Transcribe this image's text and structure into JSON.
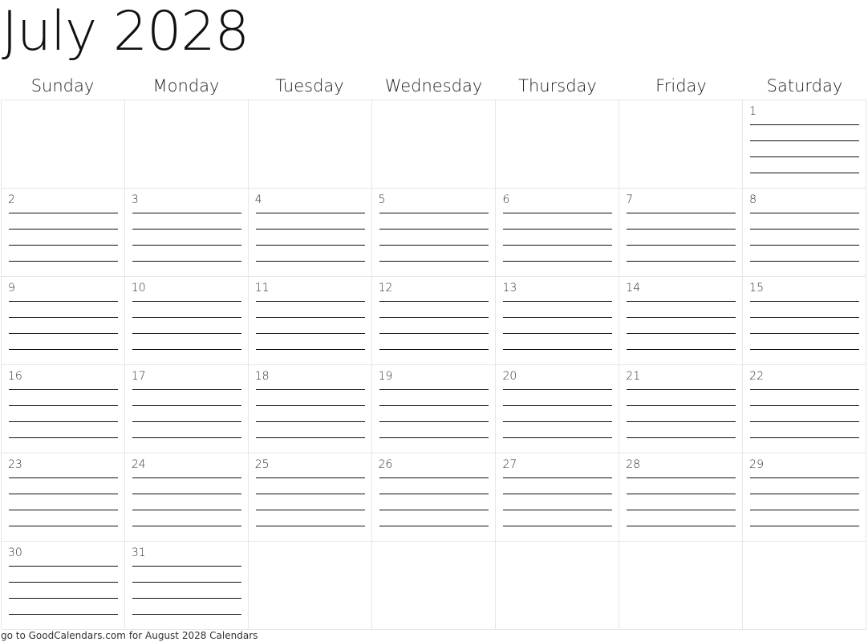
{
  "header": {
    "title": "July 2028",
    "month": "July",
    "year": "2028"
  },
  "weekdays": [
    "Sunday",
    "Monday",
    "Tuesday",
    "Wednesday",
    "Thursday",
    "Friday",
    "Saturday"
  ],
  "weeks": [
    [
      "",
      "",
      "",
      "",
      "",
      "",
      "1"
    ],
    [
      "2",
      "3",
      "4",
      "5",
      "6",
      "7",
      "8"
    ],
    [
      "9",
      "10",
      "11",
      "12",
      "13",
      "14",
      "15"
    ],
    [
      "16",
      "17",
      "18",
      "19",
      "20",
      "21",
      "22"
    ],
    [
      "23",
      "24",
      "25",
      "26",
      "27",
      "28",
      "29"
    ],
    [
      "30",
      "31",
      "",
      "",
      "",
      "",
      ""
    ]
  ],
  "lines_per_day": 4,
  "footer": {
    "text": "go to GoodCalendars.com for August 2028 Calendars"
  },
  "colors": {
    "grid": "#e6e6e6",
    "text": "#111111",
    "writing_line": "#111111"
  }
}
